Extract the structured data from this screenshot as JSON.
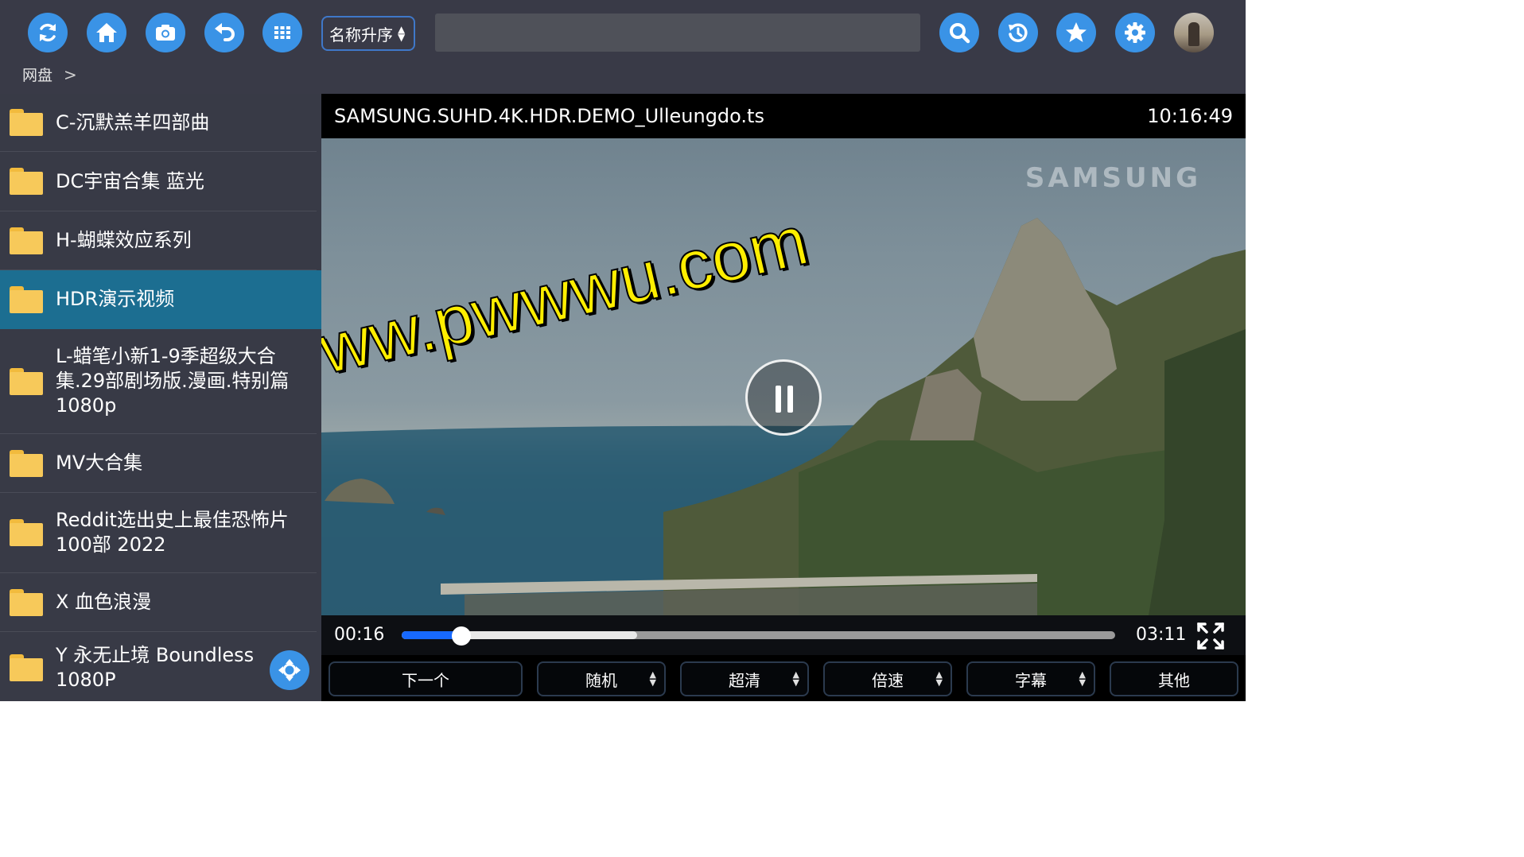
{
  "toolbar": {
    "buttons": [
      {
        "name": "refresh-icon"
      },
      {
        "name": "home-icon"
      },
      {
        "name": "camera-icon"
      },
      {
        "name": "back-icon"
      },
      {
        "name": "grid-icon"
      }
    ],
    "sort_label": "名称升序",
    "search_placeholder": "",
    "right_buttons": [
      {
        "name": "search-icon"
      },
      {
        "name": "history-icon"
      },
      {
        "name": "star-icon"
      },
      {
        "name": "gear-icon"
      }
    ],
    "accent_color": "#3a93e6"
  },
  "breadcrumb": {
    "root": "网盘",
    "separator": ">"
  },
  "sidebar": {
    "items": [
      {
        "label": "C-沉默羔羊四部曲"
      },
      {
        "label": "DC宇宙合集 蓝光"
      },
      {
        "label": "H-蝴蝶效应系列"
      },
      {
        "label": "HDR演示视频",
        "active": true
      },
      {
        "label": "L-蜡笔小新1-9季超级大合集.29部剧场版.漫画.特别篇1080p"
      },
      {
        "label": "MV大合集"
      },
      {
        "label": "Reddit选出史上最佳恐怖片100部 2022"
      },
      {
        "label": "X 血色浪漫"
      },
      {
        "label": "Y 永无止境 Boundless 1080P"
      }
    ],
    "active_color": "#1c6e91",
    "folder_color": "#f7c95a"
  },
  "player": {
    "filename": "SAMSUNG.SUHD.4K.HDR.DEMO_Ulleungdo.ts",
    "clock": "10:16:49",
    "brand_watermark": "SAMSUNG",
    "site_watermark": "www.pwwwu.com",
    "current_time": "00:16",
    "total_time": "03:11",
    "played_fraction": 0.084,
    "buffered_fraction": 0.33,
    "buttons": [
      {
        "label": "下一个",
        "dropdown": false
      },
      {
        "label": "随机",
        "dropdown": true
      },
      {
        "label": "超清",
        "dropdown": true
      },
      {
        "label": "倍速",
        "dropdown": true
      },
      {
        "label": "字幕",
        "dropdown": true
      },
      {
        "label": "其他",
        "dropdown": false
      }
    ],
    "progress_color": "#1769ff"
  }
}
